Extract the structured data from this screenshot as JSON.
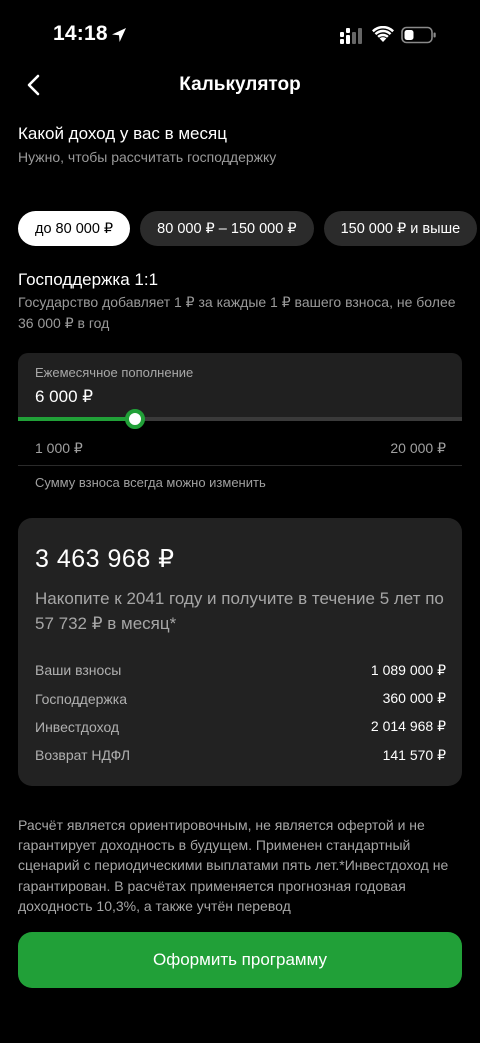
{
  "status": {
    "time": "14:18"
  },
  "nav": {
    "title": "Калькулятор"
  },
  "income": {
    "title": "Какой доход у вас в месяц",
    "subtitle": "Нужно, чтобы рассчитать господдержку",
    "options": [
      "до 80 000 ₽",
      "80 000 ₽ – 150 000 ₽",
      "150 000 ₽ и выше"
    ],
    "selected_index": 0
  },
  "support": {
    "title": "Господдержка 1:1",
    "description": "Государство добавляет 1 ₽ за каждые 1 ₽ вашего взноса, не более 36 000 ₽ в год"
  },
  "slider": {
    "label": "Ежемесячное пополнение",
    "value_text": "6 000 ₽",
    "value": 6000,
    "min": 1000,
    "max": 20000,
    "min_label": "1 000 ₽",
    "max_label": "20 000 ₽",
    "hint": "Сумму взноса всегда можно изменить"
  },
  "result": {
    "total": "3 463 968 ₽",
    "description": "Накопите к 2041 году и получите в течение 5 лет по 57 732 ₽ в месяц*",
    "rows": [
      {
        "label": "Ваши взносы",
        "value": "1 089 000 ₽"
      },
      {
        "label": "Господдержка",
        "value": "360 000 ₽"
      },
      {
        "label": "Инвестдоход",
        "value": "2 014 968 ₽"
      },
      {
        "label": "Возврат НДФЛ",
        "value": "141 570 ₽"
      }
    ]
  },
  "disclaimer": "Расчёт является ориентировочным, не является офертой и не гарантирует доходность в будущем. Применен стандартный сценарий с периодическими выплатами пять лет.*Инвестдоход не гарантирован. В расчётах применяется прогнозная годовая доходность 10,3%, а также учтён перевод",
  "cta": {
    "label": "Оформить программу"
  },
  "colors": {
    "accent": "#21a038",
    "background": "#000000",
    "card": "#222222"
  }
}
